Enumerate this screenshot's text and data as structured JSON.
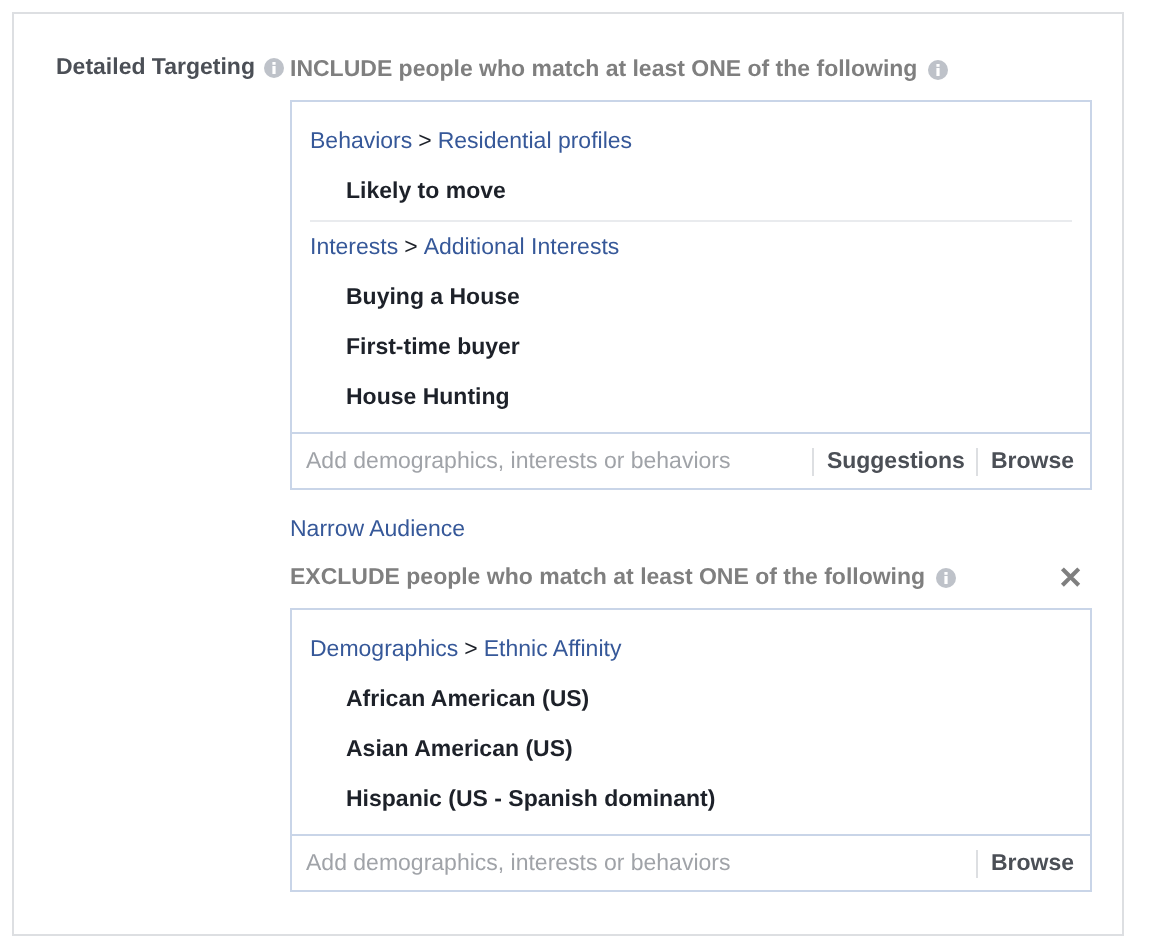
{
  "label": "Detailed Targeting",
  "include": {
    "heading": "INCLUDE people who match at least ONE of the following",
    "groups": [
      {
        "category": "Behaviors",
        "separator": ">",
        "subcategory": "Residential profiles",
        "items": [
          "Likely to move"
        ]
      },
      {
        "category": "Interests",
        "separator": ">",
        "subcategory": "Additional Interests",
        "items": [
          "Buying a House",
          "First-time buyer",
          "House Hunting"
        ]
      }
    ],
    "field": {
      "placeholder": "Add demographics, interests or behaviors"
    },
    "actions": [
      "Suggestions",
      "Browse"
    ]
  },
  "narrow_link": "Narrow Audience",
  "exclude": {
    "heading": "EXCLUDE people who match at least ONE of the following",
    "close_button": "✕",
    "groups": [
      {
        "category": "Demographics",
        "separator": ">",
        "subcategory": "Ethnic Affinity",
        "items": [
          "African American (US)",
          "Asian American (US)",
          "Hispanic (US - Spanish dominant)"
        ]
      }
    ],
    "field": {
      "placeholder": "Add demographics, interests or behaviors"
    },
    "actions": [
      "Browse"
    ]
  }
}
